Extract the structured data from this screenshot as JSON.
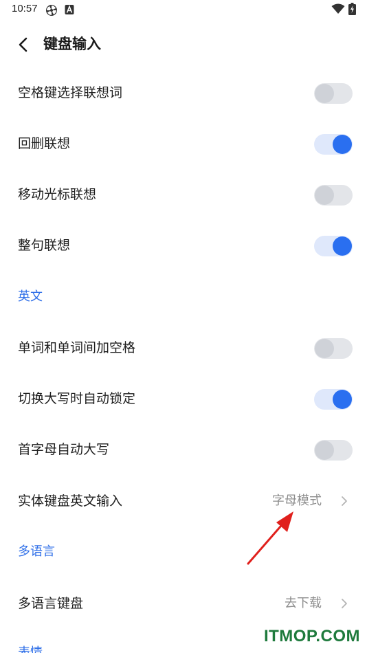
{
  "status_bar": {
    "time": "10:57",
    "icons": [
      "pinwheel-icon",
      "a-badge-icon",
      "wifi-icon",
      "battery-charging-icon"
    ]
  },
  "header": {
    "back_icon": "chevron-left-icon",
    "title": "键盘输入"
  },
  "settings": {
    "space_select": {
      "label": "空格键选择联想词",
      "enabled": false
    },
    "backspace_predict": {
      "label": "回删联想",
      "enabled": true
    },
    "cursor_predict": {
      "label": "移动光标联想",
      "enabled": false
    },
    "sentence_predict": {
      "label": "整句联想",
      "enabled": true
    }
  },
  "english": {
    "section_title": "英文",
    "word_space": {
      "label": "单词和单词间加空格",
      "enabled": false
    },
    "caps_lock_auto": {
      "label": "切换大写时自动锁定",
      "enabled": true
    },
    "auto_capitalize": {
      "label": "首字母自动大写",
      "enabled": false
    },
    "physical_keyboard": {
      "label": "实体键盘英文输入",
      "value": "字母模式"
    }
  },
  "multilang": {
    "section_title": "多语言",
    "keyboard": {
      "label": "多语言键盘",
      "value": "去下载"
    }
  },
  "next_section": {
    "section_title": "表情"
  },
  "colors": {
    "accent": "#2a6ff0",
    "section_text": "#2d6ee8",
    "toggle_off": "#e3e5e9",
    "annotation_arrow": "#e0201c",
    "watermark": "#1e7a3c"
  },
  "watermark": "ITMOP.COM"
}
